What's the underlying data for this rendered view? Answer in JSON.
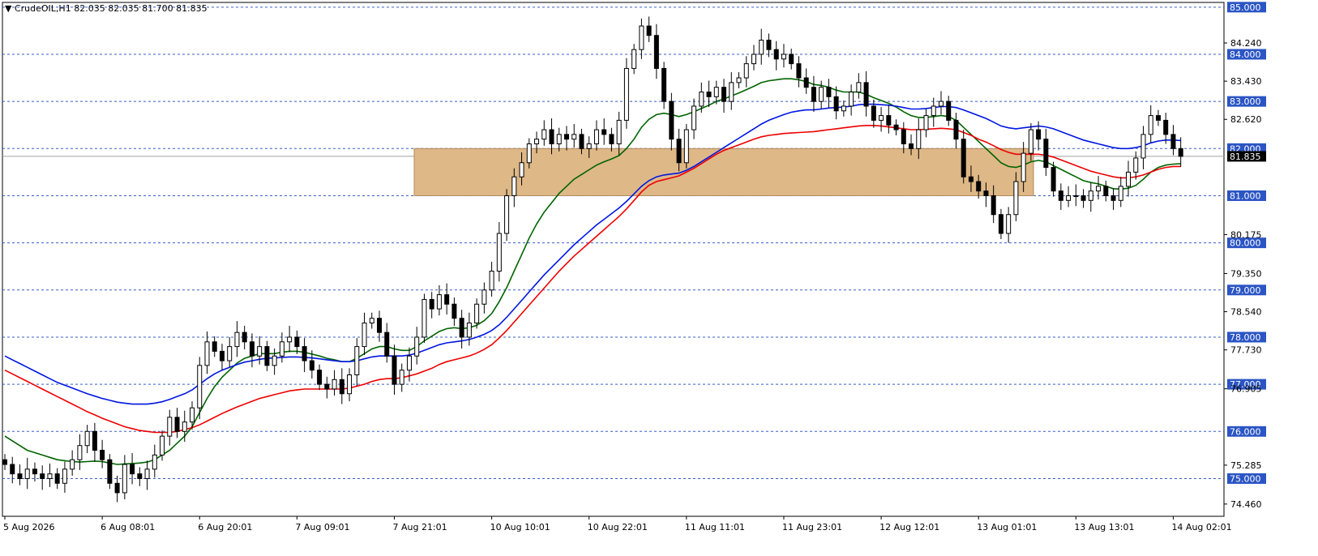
{
  "window": {
    "title": "CrudeOIL,H1",
    "ohlc": "82.035 82.035 81.700 81.835"
  },
  "colors": {
    "background": "#ffffff",
    "grid_dash": "#3a5ec7",
    "zone_fill": "#deb887",
    "candle_up": "#ffffff",
    "candle_down": "#000000",
    "ma_blue": "#0016e0",
    "ma_red": "#ee0000",
    "ma_green": "#006400",
    "label_bg": "#2b55c4",
    "price_label_bg": "#000000"
  },
  "chart_data": {
    "type": "candlestick",
    "symbol": "CrudeOIL",
    "timeframe": "H1",
    "ylim": [
      74.2,
      85.1
    ],
    "y_ticks_plain": [
      "84.240",
      "83.430",
      "82.620",
      "80.175",
      "79.350",
      "78.540",
      "77.730",
      "76.905",
      "75.285",
      "74.460"
    ],
    "y_ticks_plain_values": [
      84.24,
      83.43,
      82.62,
      80.175,
      79.35,
      78.54,
      77.73,
      76.905,
      75.285,
      74.46
    ],
    "levels": [
      "85.000",
      "84.000",
      "83.000",
      "82.000",
      "81.000",
      "80.000",
      "79.000",
      "78.000",
      "77.000",
      "76.000",
      "75.000"
    ],
    "level_values": [
      85,
      84,
      83,
      82,
      81,
      80,
      79,
      78,
      77,
      76,
      75
    ],
    "current_price": "81.835",
    "current_price_value": 81.835,
    "zone": {
      "from": 81.0,
      "to": 82.0
    },
    "x_labels": [
      "5 Aug 2026",
      "6 Aug 08:01",
      "6 Aug 20:01",
      "7 Aug 09:01",
      "7 Aug 21:01",
      "10 Aug 10:01",
      "10 Aug 22:01",
      "11 Aug 11:01",
      "11 Aug 23:01",
      "12 Aug 12:01",
      "13 Aug 01:01",
      "13 Aug 13:01",
      "14 Aug 02:01"
    ],
    "x_label_bar_index": [
      0,
      13,
      26,
      39,
      52,
      65,
      78,
      91,
      104,
      117,
      130,
      143,
      156
    ],
    "candles_close_path": [
      75.3,
      75.1,
      75.0,
      75.2,
      75.1,
      75.0,
      75.1,
      74.9,
      75.2,
      75.4,
      75.7,
      76.0,
      75.6,
      75.4,
      74.9,
      74.7,
      75.3,
      75.1,
      75.0,
      75.2,
      75.5,
      75.9,
      76.3,
      76.0,
      76.2,
      76.5,
      77.4,
      77.9,
      77.7,
      77.5,
      77.8,
      78.1,
      77.9,
      77.6,
      77.8,
      77.4,
      77.6,
      77.9,
      78.0,
      77.8,
      77.5,
      77.3,
      77.0,
      76.9,
      77.1,
      76.8,
      77.2,
      77.8,
      78.3,
      78.4,
      78.1,
      77.6,
      77.0,
      77.3,
      77.6,
      78.0,
      78.8,
      78.6,
      78.9,
      78.7,
      78.4,
      78.0,
      78.3,
      78.7,
      79.0,
      79.4,
      80.2,
      81.0,
      81.4,
      81.7,
      82.1,
      82.2,
      82.4,
      82.1,
      82.3,
      82.2,
      82.3,
      82.0,
      82.1,
      82.4,
      82.3,
      82.1,
      82.6,
      83.7,
      84.1,
      84.6,
      84.4,
      83.7,
      83.0,
      82.2,
      81.7,
      82.4,
      82.9,
      83.2,
      83.1,
      83.3,
      83.0,
      83.4,
      83.5,
      83.8,
      84.0,
      84.3,
      84.1,
      83.9,
      84.0,
      83.8,
      83.5,
      83.3,
      83.0,
      83.3,
      83.1,
      82.8,
      82.9,
      83.2,
      83.4,
      82.9,
      82.6,
      82.7,
      82.5,
      82.4,
      82.1,
      82.0,
      82.4,
      82.7,
      82.9,
      83.0,
      82.6,
      82.2,
      81.4,
      81.3,
      81.1,
      81.0,
      80.6,
      80.2,
      80.6,
      81.3,
      81.9,
      82.4,
      82.2,
      81.6,
      81.1,
      80.9,
      81.0,
      81.0,
      80.9,
      81.1,
      81.2,
      81.0,
      80.9,
      81.2,
      81.5,
      81.8,
      82.3,
      82.7,
      82.6,
      82.3,
      82.0,
      81.835
    ],
    "series": [
      {
        "color_key": "ma_green",
        "values": [
          75.9,
          75.8,
          75.7,
          75.6,
          75.55,
          75.5,
          75.45,
          75.4,
          75.38,
          75.36,
          75.35,
          75.36,
          75.37,
          75.36,
          75.33,
          75.3,
          75.31,
          75.32,
          75.33,
          75.35,
          75.4,
          75.5,
          75.6,
          75.75,
          75.9,
          76.1,
          76.4,
          76.7,
          76.95,
          77.15,
          77.3,
          77.45,
          77.55,
          77.6,
          77.65,
          77.65,
          77.65,
          77.68,
          77.7,
          77.7,
          77.68,
          77.64,
          77.6,
          77.55,
          77.52,
          77.48,
          77.48,
          77.55,
          77.65,
          77.75,
          77.8,
          77.8,
          77.75,
          77.72,
          77.72,
          77.8,
          77.92,
          78.02,
          78.12,
          78.18,
          78.2,
          78.18,
          78.2,
          78.25,
          78.35,
          78.5,
          78.75,
          79.05,
          79.4,
          79.75,
          80.1,
          80.4,
          80.65,
          80.85,
          81.05,
          81.2,
          81.35,
          81.45,
          81.55,
          81.65,
          81.72,
          81.78,
          81.85,
          82.0,
          82.2,
          82.45,
          82.62,
          82.72,
          82.75,
          82.72,
          82.68,
          82.72,
          82.78,
          82.85,
          82.92,
          83.0,
          83.05,
          83.12,
          83.18,
          83.25,
          83.32,
          83.4,
          83.44,
          83.46,
          83.48,
          83.48,
          83.46,
          83.42,
          83.36,
          83.34,
          83.3,
          83.24,
          83.2,
          83.2,
          83.2,
          83.15,
          83.08,
          83.02,
          82.96,
          82.88,
          82.78,
          82.7,
          82.66,
          82.66,
          82.68,
          82.7,
          82.68,
          82.6,
          82.45,
          82.3,
          82.15,
          82.0,
          81.85,
          81.7,
          81.62,
          81.6,
          81.65,
          81.72,
          81.75,
          81.72,
          81.64,
          81.56,
          81.48,
          81.4,
          81.32,
          81.28,
          81.25,
          81.2,
          81.15,
          81.14,
          81.16,
          81.22,
          81.35,
          81.5,
          81.6,
          81.65,
          81.67,
          81.68
        ]
      },
      {
        "color_key": "ma_blue",
        "values": [
          77.6,
          77.52,
          77.44,
          77.36,
          77.28,
          77.2,
          77.12,
          77.04,
          76.98,
          76.92,
          76.86,
          76.8,
          76.75,
          76.7,
          76.66,
          76.62,
          76.6,
          76.58,
          76.58,
          76.58,
          76.6,
          76.63,
          76.68,
          76.74,
          76.8,
          76.88,
          77.0,
          77.12,
          77.22,
          77.3,
          77.36,
          77.42,
          77.47,
          77.5,
          77.53,
          77.55,
          77.56,
          77.57,
          77.58,
          77.58,
          77.57,
          77.56,
          77.54,
          77.52,
          77.5,
          77.48,
          77.48,
          77.5,
          77.54,
          77.58,
          77.6,
          77.6,
          77.6,
          77.6,
          77.62,
          77.66,
          77.72,
          77.78,
          77.84,
          77.88,
          77.9,
          77.92,
          77.95,
          78.0,
          78.06,
          78.14,
          78.26,
          78.42,
          78.6,
          78.78,
          78.96,
          79.14,
          79.32,
          79.48,
          79.64,
          79.8,
          79.96,
          80.1,
          80.24,
          80.38,
          80.5,
          80.62,
          80.74,
          80.88,
          81.04,
          81.2,
          81.32,
          81.4,
          81.44,
          81.46,
          81.48,
          81.54,
          81.62,
          81.72,
          81.82,
          81.92,
          82.02,
          82.12,
          82.22,
          82.32,
          82.42,
          82.52,
          82.6,
          82.66,
          82.72,
          82.77,
          82.8,
          82.82,
          82.82,
          82.84,
          82.86,
          82.87,
          82.88,
          82.9,
          82.93,
          82.94,
          82.94,
          82.93,
          82.92,
          82.9,
          82.87,
          82.84,
          82.84,
          82.85,
          82.87,
          82.89,
          82.89,
          82.87,
          82.82,
          82.76,
          82.7,
          82.64,
          82.56,
          82.48,
          82.44,
          82.42,
          82.44,
          82.46,
          82.48,
          82.46,
          82.42,
          82.36,
          82.3,
          82.24,
          82.18,
          82.14,
          82.1,
          82.06,
          82.02,
          82.0,
          82.0,
          82.02,
          82.06,
          82.12,
          82.16,
          82.18,
          82.18,
          82.17
        ]
      },
      {
        "color_key": "ma_red",
        "values": [
          77.3,
          77.22,
          77.14,
          77.06,
          76.98,
          76.9,
          76.82,
          76.74,
          76.66,
          76.58,
          76.5,
          76.42,
          76.35,
          76.28,
          76.22,
          76.16,
          76.1,
          76.06,
          76.02,
          76.0,
          75.98,
          75.98,
          75.98,
          76.0,
          76.04,
          76.08,
          76.14,
          76.22,
          76.3,
          76.38,
          76.45,
          76.52,
          76.58,
          76.64,
          76.7,
          76.74,
          76.78,
          76.82,
          76.86,
          76.88,
          76.9,
          76.9,
          76.9,
          76.9,
          76.9,
          76.9,
          76.92,
          76.96,
          77.0,
          77.06,
          77.1,
          77.12,
          77.12,
          77.14,
          77.18,
          77.22,
          77.28,
          77.34,
          77.42,
          77.48,
          77.52,
          77.56,
          77.6,
          77.66,
          77.74,
          77.84,
          77.98,
          78.14,
          78.32,
          78.5,
          78.68,
          78.86,
          79.04,
          79.22,
          79.4,
          79.56,
          79.72,
          79.86,
          80.0,
          80.14,
          80.28,
          80.42,
          80.56,
          80.72,
          80.9,
          81.08,
          81.22,
          81.3,
          81.34,
          81.38,
          81.42,
          81.5,
          81.58,
          81.68,
          81.78,
          81.88,
          81.96,
          82.02,
          82.08,
          82.14,
          82.2,
          82.25,
          82.28,
          82.3,
          82.32,
          82.33,
          82.34,
          82.35,
          82.36,
          82.38,
          82.4,
          82.42,
          82.44,
          82.46,
          82.48,
          82.49,
          82.49,
          82.48,
          82.46,
          82.44,
          82.42,
          82.4,
          82.4,
          82.41,
          82.42,
          82.43,
          82.42,
          82.4,
          82.34,
          82.28,
          82.2,
          82.14,
          82.06,
          81.98,
          81.92,
          81.88,
          81.88,
          81.88,
          81.88,
          81.86,
          81.82,
          81.76,
          81.7,
          81.64,
          81.58,
          81.52,
          81.48,
          81.44,
          81.4,
          81.38,
          81.38,
          81.4,
          81.44,
          81.5,
          81.56,
          81.6,
          81.62,
          81.62
        ]
      }
    ]
  }
}
